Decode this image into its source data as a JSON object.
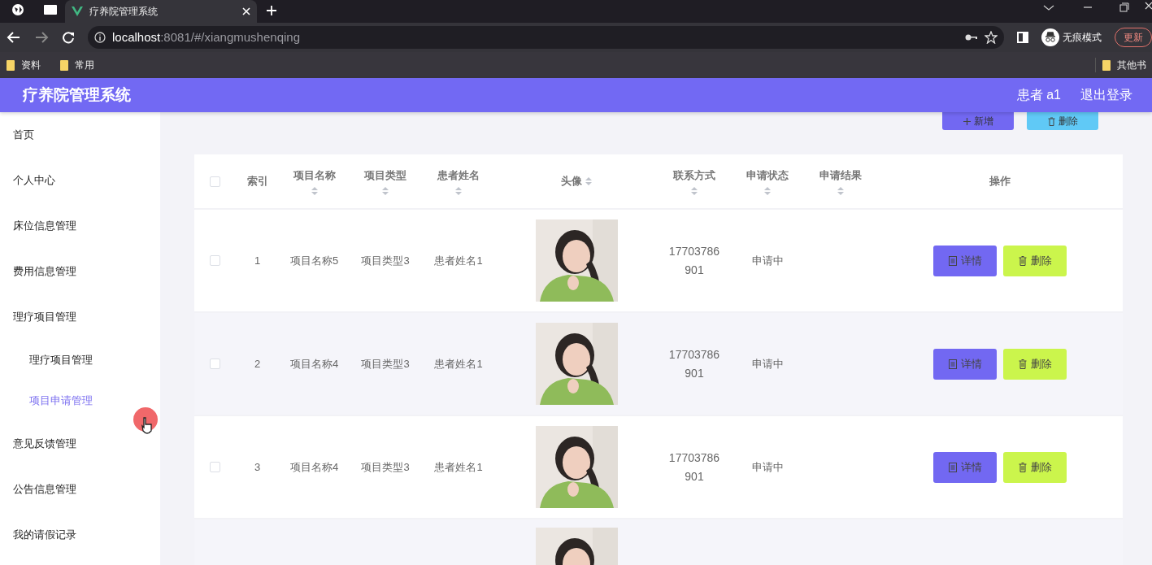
{
  "browser": {
    "tab": {
      "title": "疗养院管理系统",
      "selected": true
    },
    "url": {
      "host": "localhost",
      "path": ":8081/#/xiangmushenqing"
    },
    "profile": "无痕模式",
    "update_button": "更新",
    "bookmarks": [
      {
        "label": "资料"
      },
      {
        "label": "常用"
      }
    ],
    "other_bookmarks": "其他书"
  },
  "app": {
    "title": "疗养院管理系统",
    "user": "患者 a1",
    "logout": "退出登录"
  },
  "sidebar": {
    "items": [
      {
        "label": "首页",
        "selected": false
      },
      {
        "label": "个人中心",
        "selected": false
      },
      {
        "label": "床位信息管理",
        "selected": false
      },
      {
        "label": "费用信息管理",
        "selected": false
      },
      {
        "label": "理疗项目管理",
        "selected": false,
        "children": [
          {
            "label": "理疗项目管理",
            "selected": false
          },
          {
            "label": "项目申请管理",
            "selected": true
          }
        ]
      },
      {
        "label": "意见反馈管理",
        "selected": false
      },
      {
        "label": "公告信息管理",
        "selected": false
      },
      {
        "label": "我的请假记录",
        "selected": false
      }
    ]
  },
  "toolbar": {
    "buttons": [
      {
        "label": "新增",
        "kind": "add"
      },
      {
        "label": "删除",
        "kind": "delete"
      }
    ]
  },
  "table": {
    "select_all": {
      "checked": false
    },
    "columns": [
      {
        "label": "索引",
        "sortable": false,
        "kind": "text"
      },
      {
        "label": "项目名称",
        "sortable": true,
        "kind": "text"
      },
      {
        "label": "项目类型",
        "sortable": true,
        "kind": "text"
      },
      {
        "label": "患者姓名",
        "sortable": true,
        "kind": "text"
      },
      {
        "label": "头像",
        "sortable": true
      },
      {
        "label": "联系方式",
        "sortable": true,
        "kind": "text"
      },
      {
        "label": "申请状态",
        "sortable": true,
        "kind": "text"
      },
      {
        "label": "申请结果",
        "sortable": true,
        "kind": "text"
      },
      {
        "label": "操作",
        "sortable": false,
        "kind": "actions"
      }
    ],
    "rows": [
      {
        "checked": false,
        "cells": [
          "1",
          "项目名称5",
          "项目类型3",
          "患者姓名1",
          {
            "kind": "picture"
          },
          "17703786901",
          "申请中",
          ""
        ],
        "actions": [
          {
            "label": "详情",
            "kind": "detail"
          },
          {
            "label": "删除",
            "kind": "delete"
          }
        ]
      },
      {
        "checked": false,
        "cells": [
          "2",
          "项目名称4",
          "项目类型3",
          "患者姓名1",
          {
            "kind": "picture"
          },
          "17703786901",
          "申请中",
          ""
        ],
        "actions": [
          {
            "label": "详情",
            "kind": "detail"
          },
          {
            "label": "删除",
            "kind": "delete"
          }
        ]
      },
      {
        "checked": false,
        "cells": [
          "3",
          "项目名称4",
          "项目类型3",
          "患者姓名1",
          {
            "kind": "picture"
          },
          "17703786901",
          "申请中",
          ""
        ],
        "actions": [
          {
            "label": "详情",
            "kind": "detail"
          },
          {
            "label": "删除",
            "kind": "delete"
          }
        ]
      }
    ],
    "partial_row": {
      "kind": "picture"
    }
  }
}
